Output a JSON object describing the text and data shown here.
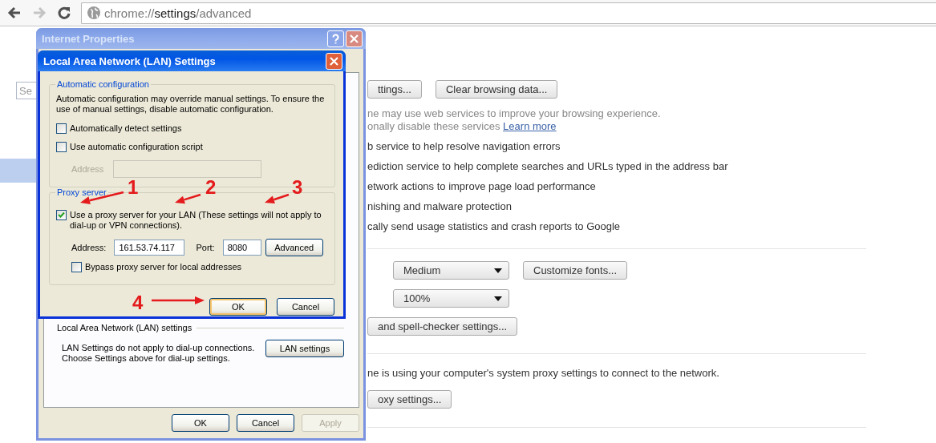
{
  "browser": {
    "nav_buttons": [
      {
        "kind": "back",
        "disabled": false
      },
      {
        "kind": "forward",
        "disabled": true
      },
      {
        "kind": "reload",
        "disabled": false
      }
    ],
    "address": [
      {
        "text": "chrome://",
        "strong": false
      },
      {
        "text": "settings",
        "strong": true
      },
      {
        "text": "/advanced",
        "strong": false
      }
    ]
  },
  "sidebar": {
    "search": {
      "placeholder": "Se"
    },
    "items": [
      {
        "selected": true
      }
    ]
  },
  "settings": {
    "sections": [
      {
        "rows": [
          {
            "kind": "controls",
            "items": [
              {
                "kind": "button",
                "label": "ttings..."
              },
              {
                "kind": "button",
                "label": "Clear browsing data..."
              }
            ]
          },
          {
            "kind": "note",
            "lines": [
              {
                "text": "ne may use web services to improve your browsing experience."
              },
              {
                "text": "onally disable these services",
                "link": "Learn more"
              }
            ]
          },
          {
            "kind": "option",
            "text": "b service to help resolve navigation errors"
          },
          {
            "kind": "option",
            "text": "ediction service to help complete searches and URLs typed in the address bar"
          },
          {
            "kind": "option",
            "text": "etwork actions to improve page load performance"
          },
          {
            "kind": "option",
            "text": "nishing and malware protection"
          },
          {
            "kind": "option",
            "text": "cally send usage statistics and crash reports to Google"
          }
        ]
      },
      {
        "rows": [
          {
            "kind": "controls",
            "items": [
              {
                "kind": "select",
                "label": "Medium"
              },
              {
                "kind": "button",
                "label": "Customize fonts..."
              }
            ]
          },
          {
            "kind": "controls",
            "items": [
              {
                "kind": "select",
                "label": "100%"
              }
            ]
          },
          {
            "kind": "controls",
            "items": [
              {
                "kind": "button",
                "label": "and spell-checker settings..."
              }
            ]
          }
        ]
      },
      {
        "rows": [
          {
            "kind": "text",
            "text": "ne is using your computer's system proxy settings to connect to the network."
          },
          {
            "kind": "controls",
            "items": [
              {
                "kind": "button",
                "label": "oxy settings..."
              }
            ]
          }
        ]
      }
    ]
  },
  "internet_properties": {
    "title": "Internet Properties",
    "active": false,
    "title_buttons": [
      {
        "kind": "help"
      },
      {
        "kind": "close"
      }
    ],
    "lan_group": {
      "title": "Local Area Network (LAN) settings",
      "lines": [
        "LAN Settings do not apply to dial-up connections.",
        "Choose Settings above for dial-up settings."
      ],
      "button": "LAN settings"
    },
    "buttons": [
      {
        "label": "OK",
        "disabled": false
      },
      {
        "label": "Cancel",
        "disabled": false
      },
      {
        "label": "Apply",
        "disabled": true
      }
    ]
  },
  "lan_settings": {
    "title": "Local Area Network (LAN) Settings",
    "active": true,
    "auto_group": {
      "title": "Automatic configuration",
      "description": "Automatic configuration may override manual settings.  To ensure the use of manual settings, disable automatic configuration.",
      "options": [
        {
          "label": "Automatically detect settings",
          "checked": false
        },
        {
          "label": "Use automatic configuration script",
          "checked": false
        }
      ],
      "address": {
        "label": "Address",
        "disabled": true
      }
    },
    "proxy_group": {
      "title": "Proxy server",
      "use_proxy": {
        "label": "Use a proxy server for your LAN (These settings will not apply to dial-up or VPN connections).",
        "checked": true
      },
      "address_label": "Address:",
      "address": "161.53.74.117",
      "port_label": "Port:",
      "port": "8080",
      "advanced_button": "Advanced",
      "bypass": {
        "label": "Bypass proxy server for local addresses",
        "checked": false
      }
    },
    "buttons": [
      {
        "label": "OK",
        "focused": true
      },
      {
        "label": "Cancel",
        "focused": false
      }
    ]
  },
  "annotations": [
    {
      "number": "1"
    },
    {
      "number": "2"
    },
    {
      "number": "3"
    },
    {
      "number": "4"
    }
  ]
}
